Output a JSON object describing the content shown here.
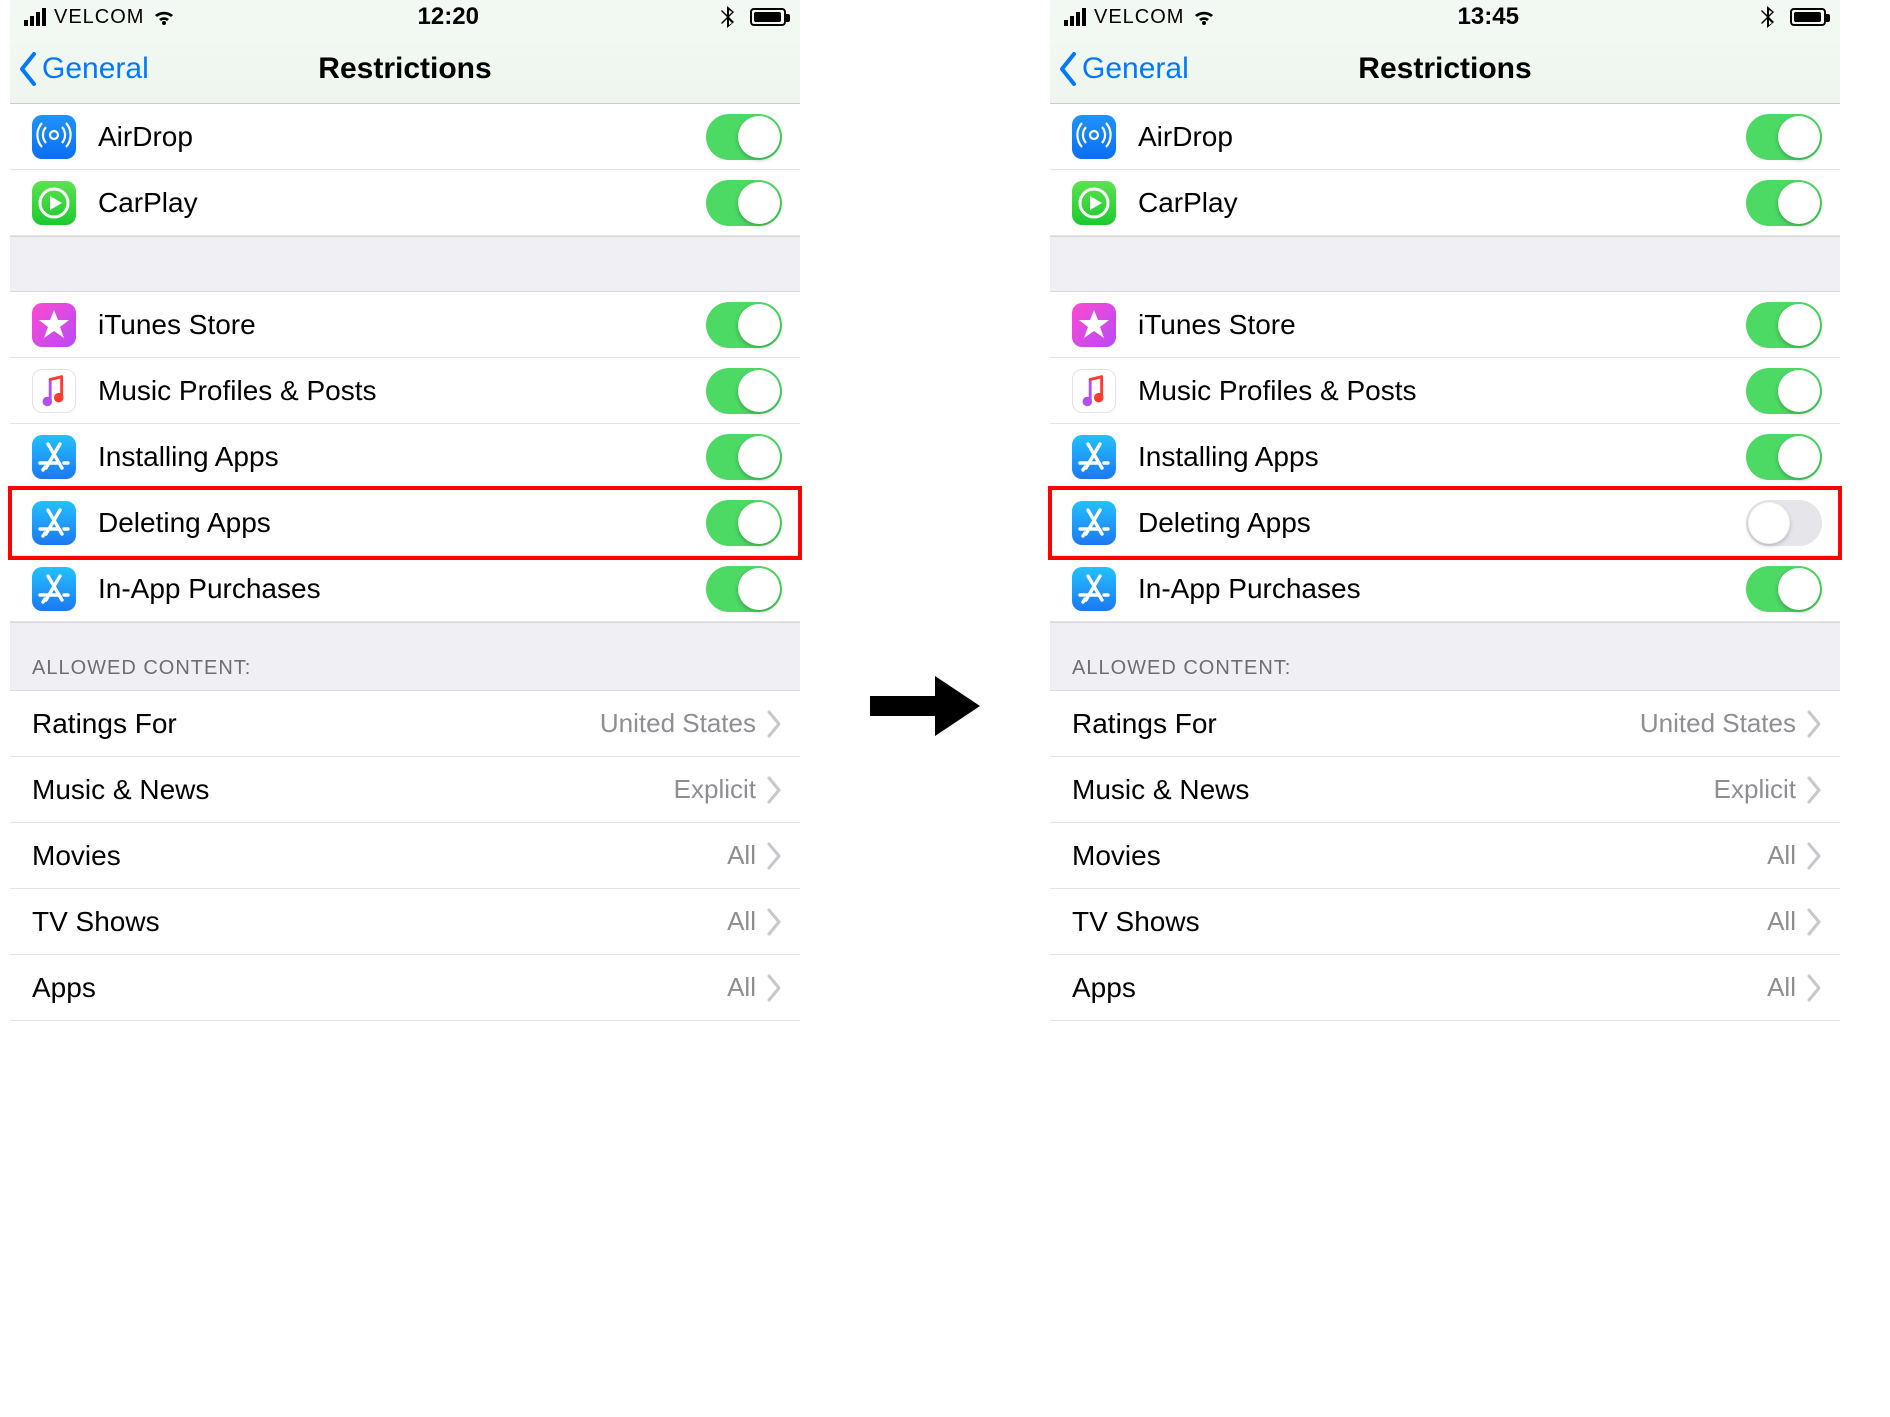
{
  "screens": [
    {
      "status": {
        "carrier": "VELCOM",
        "time": "12:20"
      },
      "nav": {
        "back": "General",
        "title": "Restrictions"
      },
      "group1": [
        {
          "icon": "airdrop",
          "label": "AirDrop",
          "on": true
        },
        {
          "icon": "carplay",
          "label": "CarPlay",
          "on": true
        }
      ],
      "group2": [
        {
          "icon": "itunes",
          "label": "iTunes Store",
          "on": true
        },
        {
          "icon": "music",
          "label": "Music Profiles & Posts",
          "on": true
        },
        {
          "icon": "appstore",
          "label": "Installing Apps",
          "on": true
        },
        {
          "icon": "appstore",
          "label": "Deleting Apps",
          "on": true,
          "highlight": true
        },
        {
          "icon": "appstore",
          "label": "In-App Purchases",
          "on": true
        }
      ],
      "allowed_header": "ALLOWED CONTENT:",
      "allowed": [
        {
          "label": "Ratings For",
          "value": "United States"
        },
        {
          "label": "Music & News",
          "value": "Explicit"
        },
        {
          "label": "Movies",
          "value": "All"
        },
        {
          "label": "TV Shows",
          "value": "All"
        },
        {
          "label": "Apps",
          "value": "All"
        }
      ]
    },
    {
      "status": {
        "carrier": "VELCOM",
        "time": "13:45"
      },
      "nav": {
        "back": "General",
        "title": "Restrictions"
      },
      "group1": [
        {
          "icon": "airdrop",
          "label": "AirDrop",
          "on": true
        },
        {
          "icon": "carplay",
          "label": "CarPlay",
          "on": true
        }
      ],
      "group2": [
        {
          "icon": "itunes",
          "label": "iTunes Store",
          "on": true
        },
        {
          "icon": "music",
          "label": "Music Profiles & Posts",
          "on": true
        },
        {
          "icon": "appstore",
          "label": "Installing Apps",
          "on": true
        },
        {
          "icon": "appstore",
          "label": "Deleting Apps",
          "on": false,
          "highlight": true
        },
        {
          "icon": "appstore",
          "label": "In-App Purchases",
          "on": true
        }
      ],
      "allowed_header": "ALLOWED CONTENT:",
      "allowed": [
        {
          "label": "Ratings For",
          "value": "United States"
        },
        {
          "label": "Music & News",
          "value": "Explicit"
        },
        {
          "label": "Movies",
          "value": "All"
        },
        {
          "label": "TV Shows",
          "value": "All"
        },
        {
          "label": "Apps",
          "value": "All"
        }
      ]
    }
  ]
}
